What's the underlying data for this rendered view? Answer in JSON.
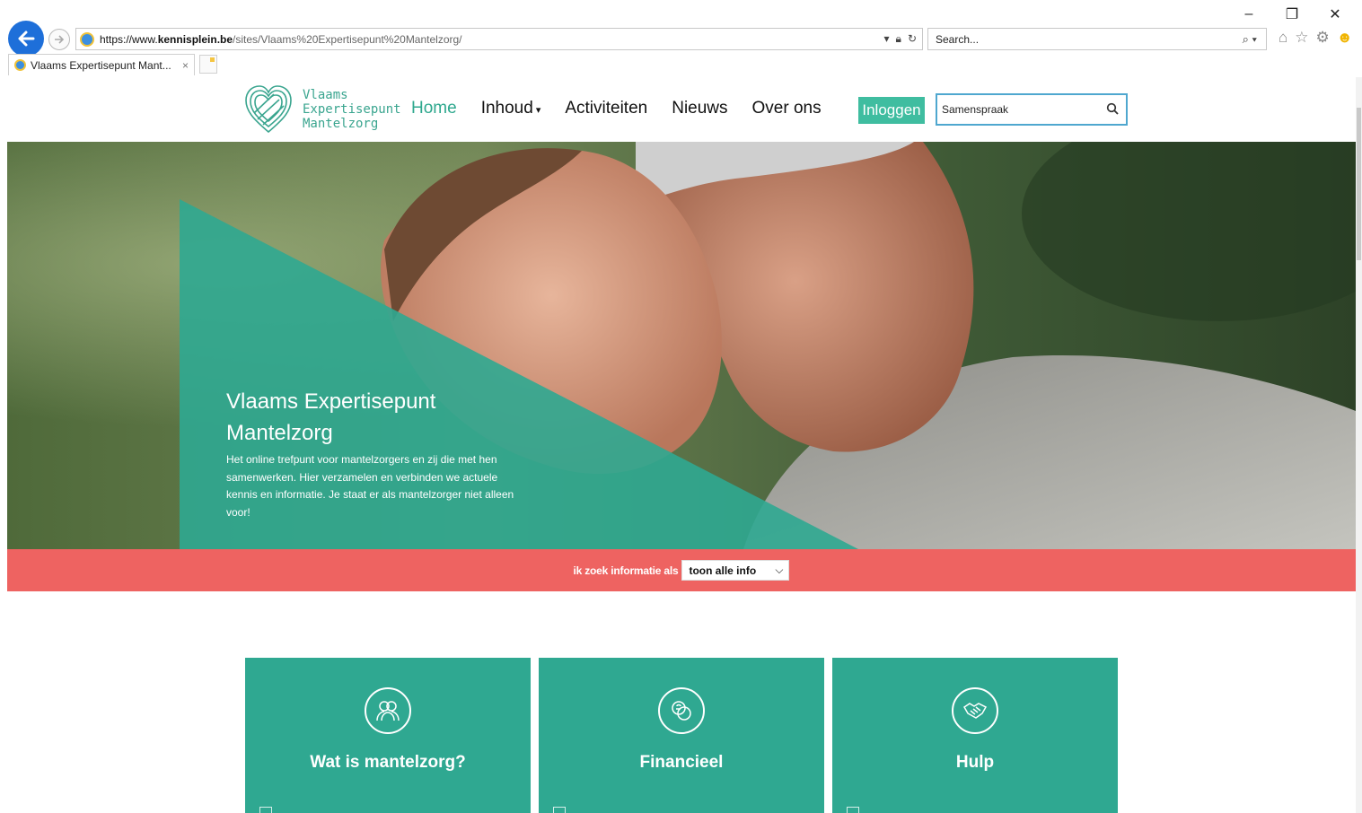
{
  "browser": {
    "url_prefix": "https://www.",
    "url_host": "kennisplein.be",
    "url_path": "/sites/Vlaams%20Expertisepunt%20Mantelzorg/",
    "search_placeholder": "Search...",
    "tab_title": "Vlaams Expertisepunt Mant...",
    "tab_close": "×",
    "window_controls": [
      "–",
      "❐",
      "✕"
    ]
  },
  "site": {
    "logo_lines": [
      "Vlaams",
      "Expertisepunt",
      "Mantelzorg"
    ],
    "nav": [
      {
        "label": "Home",
        "active": true
      },
      {
        "label": "Inhoud",
        "dropdown": true
      },
      {
        "label": "Activiteiten"
      },
      {
        "label": "Nieuws"
      },
      {
        "label": "Over ons"
      }
    ],
    "login_label": "Inloggen",
    "search_value": "Samenspraak"
  },
  "hero": {
    "title": "Vlaams Expertisepunt Mantelzorg",
    "description": "Het online trefpunt voor mantelzorgers en zij die met hen samenwerken. Hier verzamelen en verbinden we actuele kennis en informatie. Je staat er als mantelzorger niet alleen voor!"
  },
  "filter": {
    "label": "ik zoek informatie als",
    "selected": "toon alle info"
  },
  "cards": [
    {
      "title": "Wat is mantelzorg?",
      "icon": "people-icon"
    },
    {
      "title": "Financieel",
      "icon": "coins-icon"
    },
    {
      "title": "Hulp",
      "icon": "handshake-icon"
    }
  ],
  "colors": {
    "accent": "#2fa891",
    "login": "#3fbda0",
    "filter_bar": "#ee6361",
    "search_border": "#4fa7cf"
  }
}
